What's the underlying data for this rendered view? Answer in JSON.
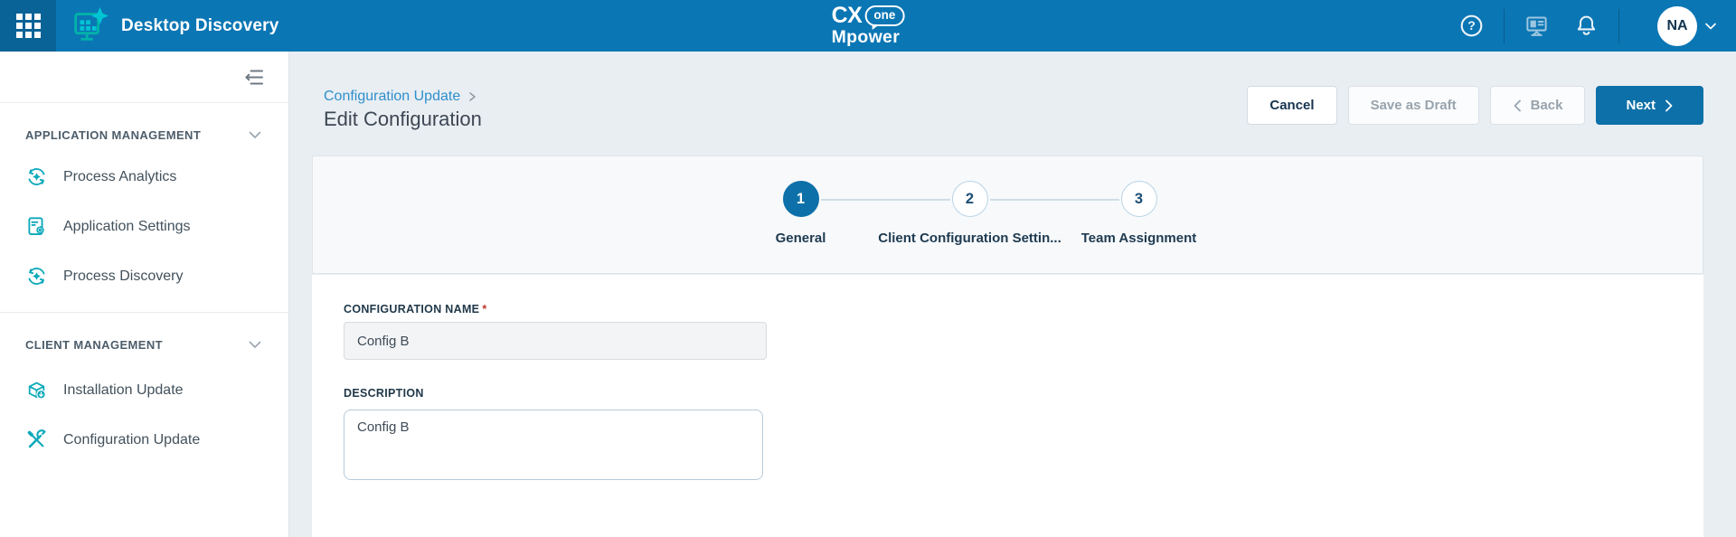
{
  "colors": {
    "header_bg": "#0b76b4",
    "waffle_bg": "#0a6397",
    "brand_blue": "#0d70a8",
    "teal_icon": "#0ca9ba",
    "content_bg": "#e9eef3",
    "breadcrumb_link": "#2e8fcb"
  },
  "header": {
    "app_title": "Desktop Discovery",
    "brand": {
      "cx": "CX",
      "one": "one",
      "mpower": "Mpower"
    },
    "avatar_initials": "NA"
  },
  "sidebar": {
    "sections": [
      {
        "label": "APPLICATION MANAGEMENT",
        "items": [
          {
            "label": "Process Analytics"
          },
          {
            "label": "Application Settings"
          },
          {
            "label": "Process Discovery"
          }
        ]
      },
      {
        "label": "CLIENT MANAGEMENT",
        "items": [
          {
            "label": "Installation Update"
          },
          {
            "label": "Configuration Update"
          }
        ]
      }
    ]
  },
  "breadcrumb": {
    "parent": "Configuration Update"
  },
  "page_title": "Edit Configuration",
  "actions": {
    "cancel": "Cancel",
    "save_as_draft": "Save as Draft",
    "back": "Back",
    "next": "Next"
  },
  "stepper": {
    "steps": [
      {
        "number": "1",
        "label": "General",
        "state": "active"
      },
      {
        "number": "2",
        "label": "Client Configuration Settin...",
        "state": "upcoming"
      },
      {
        "number": "3",
        "label": "Team Assignment",
        "state": "upcoming"
      }
    ]
  },
  "form": {
    "configuration_name": {
      "label": "CONFIGURATION NAME",
      "required_marker": "*",
      "value": "Config B"
    },
    "description": {
      "label": "DESCRIPTION",
      "value": "Config B"
    }
  }
}
